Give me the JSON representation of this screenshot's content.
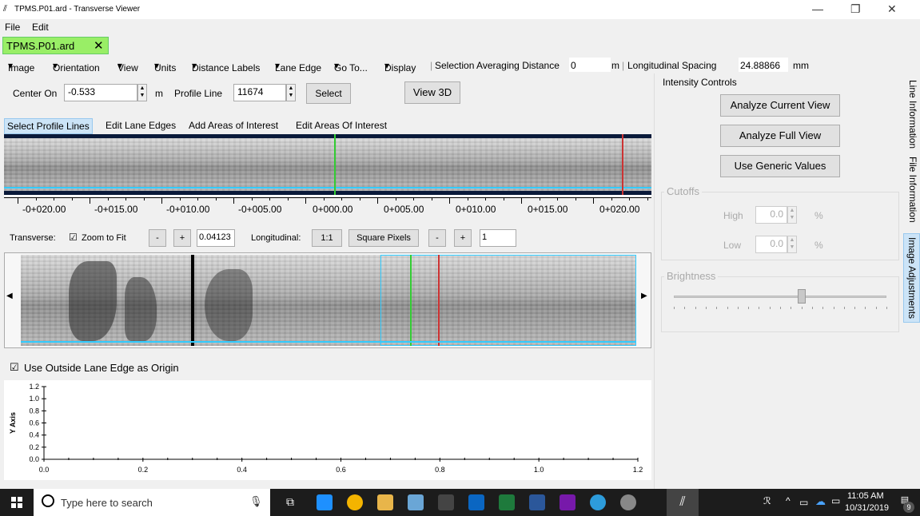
{
  "window": {
    "title": "TPMS.P01.ard - Transverse Viewer"
  },
  "menu": [
    "File",
    "Edit"
  ],
  "doc_tab": {
    "label": "TPMS.P01.ard"
  },
  "toolbar": {
    "items": [
      "Image",
      "Orientation",
      "View",
      "Units",
      "Distance Labels",
      "Lane Edge",
      "Go To...",
      "Display"
    ],
    "sel_avg_label": "Selection Averaging Distance",
    "sel_avg_value": "0",
    "sel_avg_unit": "m",
    "long_spacing_label": "Longitudinal Spacing",
    "long_spacing_value": "24.88866",
    "long_spacing_unit": "mm"
  },
  "center": {
    "label": "Center On",
    "value": "-0.533",
    "unit": "m",
    "profile_label": "Profile Line",
    "profile_value": "11674",
    "select_button": "Select",
    "view3d_button": "View 3D"
  },
  "mode_tabs": [
    "Select Profile Lines",
    "Edit Lane Edges",
    "Add Areas of Interest",
    "Edit Areas Of Interest"
  ],
  "ruler_labels": [
    "-0+020.00",
    "-0+015.00",
    "-0+010.00",
    "-0+005.00",
    "0+000.00",
    "0+005.00",
    "0+010.00",
    "0+015.00",
    "0+020.00"
  ],
  "transverse": {
    "label": "Transverse:",
    "zoom_fit": "Zoom to Fit",
    "minus": "-",
    "plus": "+",
    "value": "0.04123",
    "long_label": "Longitudinal:",
    "ratio_button": "1:1",
    "square_button": "Square Pixels",
    "long_value": "1"
  },
  "lane_origin": {
    "label": "Use Outside Lane Edge as Origin",
    "checked": true
  },
  "chart_data": {
    "type": "line",
    "series": [],
    "xlabel": "",
    "ylabel": "Y Axis",
    "xlim": [
      0,
      1.2
    ],
    "ylim": [
      0,
      1.2
    ],
    "x_ticks": [
      "0.0",
      "0.2",
      "0.4",
      "0.6",
      "0.8",
      "1.0",
      "1.2"
    ],
    "y_ticks": [
      "0.0",
      "0.2",
      "0.4",
      "0.6",
      "0.8",
      "1.0",
      "1.2"
    ],
    "grid": false
  },
  "intensity": {
    "title": "Intensity Controls",
    "analyze_current": "Analyze Current View",
    "analyze_full": "Analyze Full View",
    "generic": "Use Generic Values",
    "cutoffs": "Cutoffs",
    "high_label": "High",
    "high_value": "0.0",
    "low_label": "Low",
    "low_value": "0.0",
    "pct": "%",
    "brightness": "Brightness",
    "brightness_level": 0.6
  },
  "side_tabs": [
    "Line Information",
    "File Information",
    "Image Adjustments"
  ],
  "taskbar": {
    "search_placeholder": "Type here to search",
    "time": "11:05 AM",
    "date": "10/31/2019",
    "notif_count": "9"
  },
  "colors": {
    "accent": "#99ee66",
    "selected_tab": "#cce4f7",
    "cyan_line": "#33ccff",
    "green_marker": "#33cc33",
    "red_marker": "#cc3333"
  }
}
